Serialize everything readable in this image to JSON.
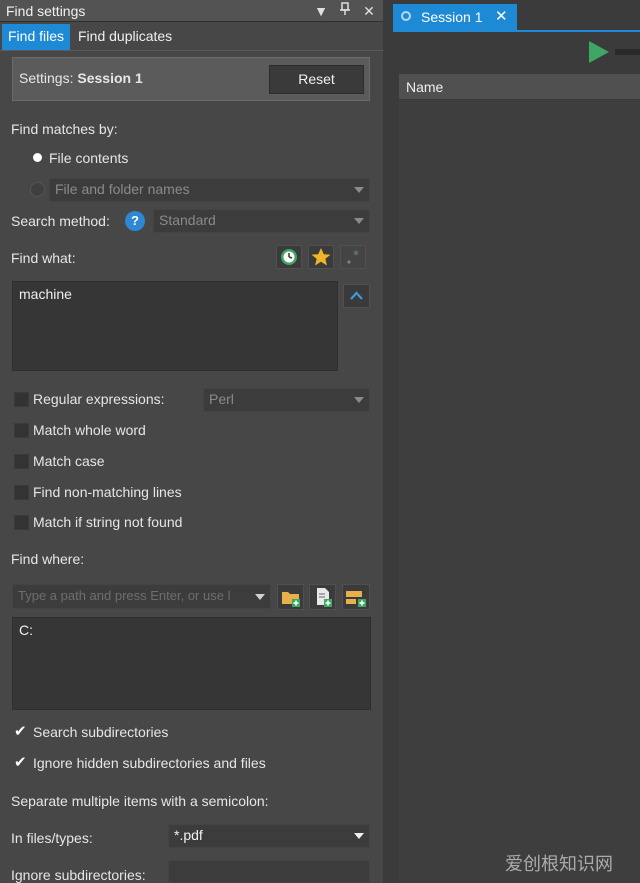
{
  "find_settings": {
    "title": "Find settings",
    "tabs": [
      "Find files",
      "Find duplicates"
    ],
    "settings_label": "Settings:",
    "settings_name": "Session 1",
    "reset_label": "Reset",
    "find_matches_by_label": "Find matches by:",
    "option_file_contents": "File contents",
    "option_file_folder_names": "File and folder names",
    "search_method_label": "Search method:",
    "search_method_value": "Standard",
    "find_what_label": "Find what:",
    "find_what_value": "machine",
    "regex_label": "Regular expressions:",
    "regex_value": "Perl",
    "match_whole_word": "Match whole word",
    "match_case": "Match case",
    "find_non_matching": "Find non-matching lines",
    "match_if_not_found": "Match if string not found",
    "find_where_label": "Find where:",
    "path_placeholder": "Type a path and press Enter, or use l",
    "paths_value": "C:",
    "search_subdirs": "Search subdirectories",
    "ignore_hidden": "Ignore hidden subdirectories and files",
    "separate_note": "Separate multiple items with a semicolon:",
    "in_files_label": "In files/types:",
    "in_files_value": "*.pdf",
    "ignore_subdirs_label": "Ignore subdirectories:"
  },
  "session": {
    "tab_label": "Session 1",
    "name_header": "Name"
  },
  "watermark": "爱创根知识网",
  "colors": {
    "accent": "#1e8ad6",
    "play": "#3fa764",
    "star": "#f0b429",
    "history": "#3fa764"
  }
}
